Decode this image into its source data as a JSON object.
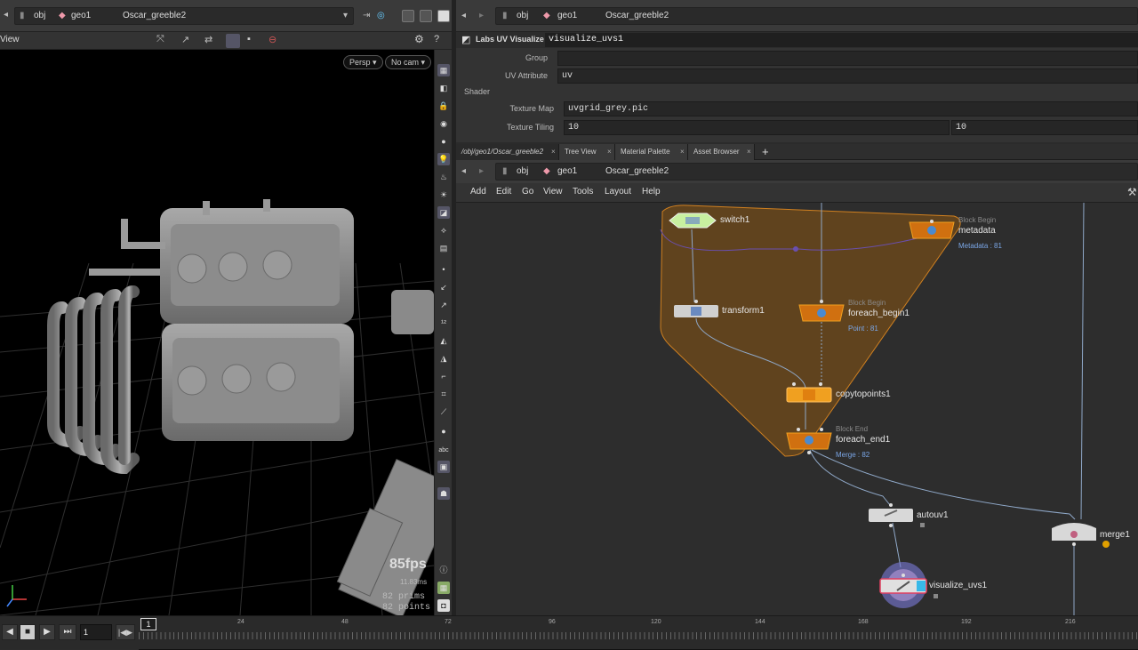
{
  "left_path": {
    "obj": "obj",
    "geo": "geo1",
    "node": "Oscar_greeble2"
  },
  "viewport": {
    "title": "View",
    "persp": "Persp",
    "cam": "No cam",
    "fps": "85fps",
    "ms": "11.83ms",
    "prims": "82  prims",
    "points": "82  points"
  },
  "sidebar": {
    "abc": "abc"
  },
  "right_path": {
    "obj": "obj",
    "geo": "geo1",
    "node": "Oscar_greeble2"
  },
  "params": {
    "node_type": "Labs UV Visualize",
    "node_name": "visualize_uvs1",
    "group_label": "Group",
    "group_value": "",
    "uvattr_label": "UV Attribute",
    "uvattr_value": "uv",
    "shader_label": "Shader",
    "texmap_label": "Texture Map",
    "texmap_value": "uvgrid_grey.pic",
    "tiling_label": "Texture Tiling",
    "tiling_x": "10",
    "tiling_y": "10"
  },
  "tabs": [
    {
      "label": "/obj/geo1/Oscar_greeble2"
    },
    {
      "label": "Tree View"
    },
    {
      "label": "Material Palette"
    },
    {
      "label": "Asset Browser"
    }
  ],
  "net_path": {
    "obj": "obj",
    "geo": "geo1",
    "node": "Oscar_greeble2"
  },
  "menu": [
    "Add",
    "Edit",
    "Go",
    "View",
    "Tools",
    "Layout",
    "Help"
  ],
  "nodes": {
    "switch1": "switch1",
    "metadata": {
      "name": "metadata",
      "block": "Block Begin",
      "sub": "Metadata : 81"
    },
    "transform1": "transform1",
    "foreach_begin1": {
      "name": "foreach_begin1",
      "block": "Block Begin",
      "sub": "Point : 81"
    },
    "copytopoints1": "copytopoints1",
    "foreach_end1": {
      "name": "foreach_end1",
      "block": "Block End",
      "sub": "Merge : 82"
    },
    "autouv1": "autouv1",
    "merge1": "merge1",
    "visualize_uvs1": "visualize_uvs1"
  },
  "timeline": {
    "frame": "1",
    "start_marker": "1",
    "ticks": [
      "24",
      "48",
      "72",
      "96",
      "120",
      "144",
      "168",
      "192",
      "216"
    ]
  },
  "colors": {
    "accent": "#f0a020",
    "block": "#c06a10",
    "switch": "#c8f0a0",
    "sub_text": "#7aa6e6"
  }
}
